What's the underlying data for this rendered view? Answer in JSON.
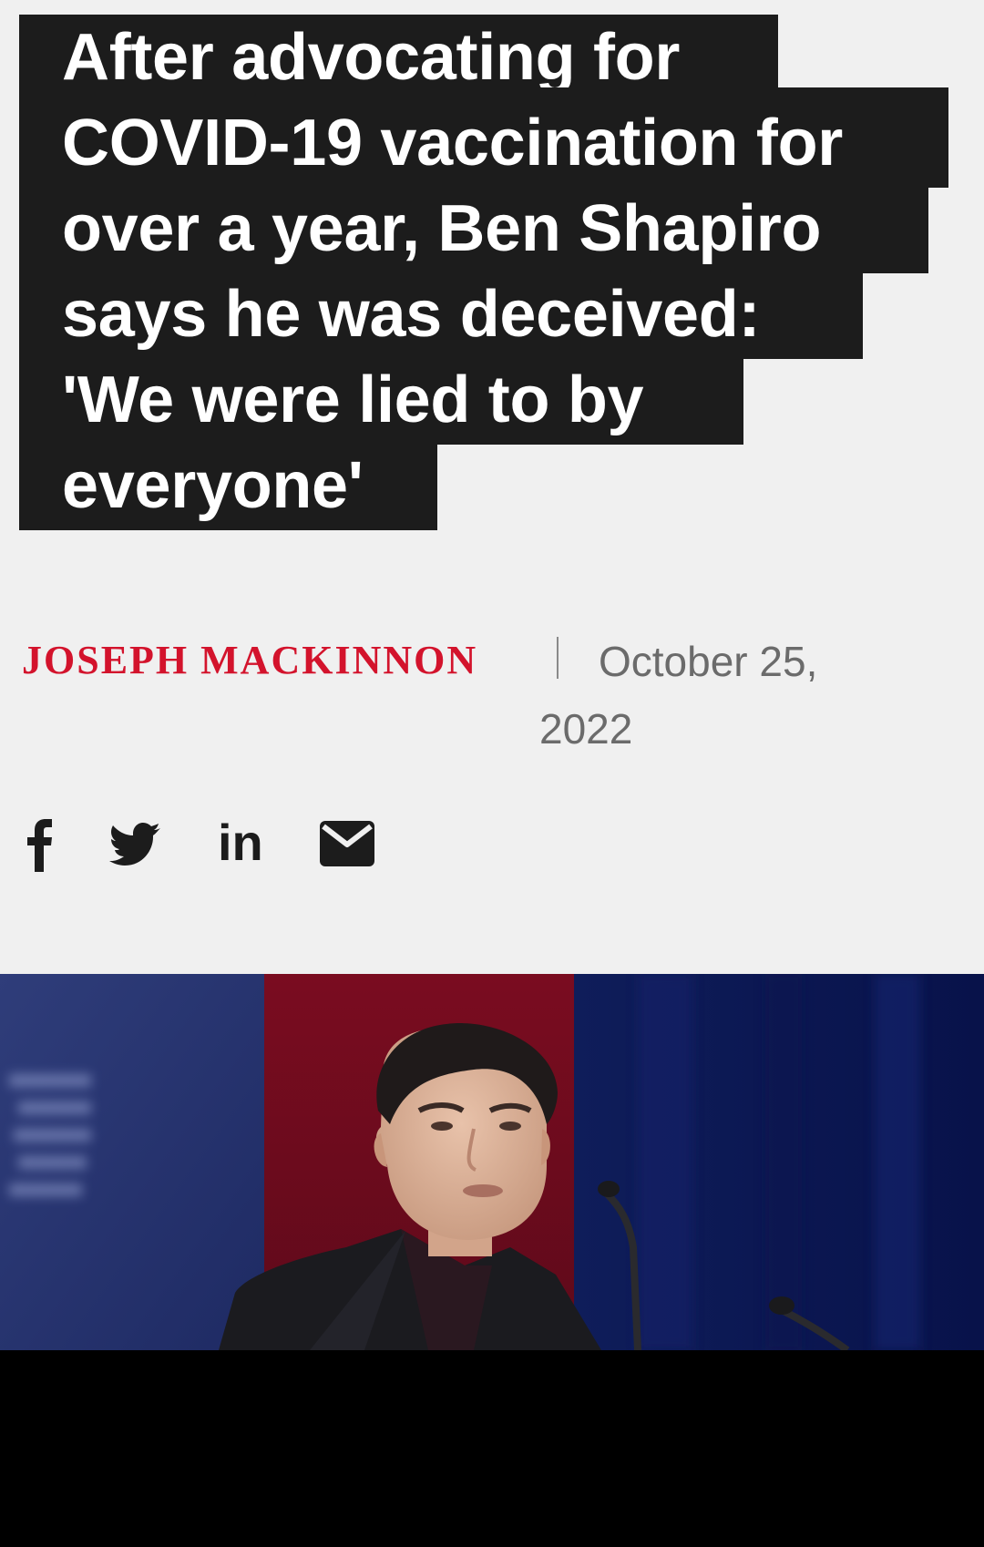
{
  "article": {
    "headline_lines": [
      "After advocating for",
      "COVID-19 vaccination for",
      "over a year, Ben Shapiro",
      "says he was deceived:",
      "'We were lied to by",
      "everyone'"
    ],
    "author": "JOSEPH MACKINNON",
    "date_line1": "October 25,",
    "date_line2": "2022"
  },
  "share": {
    "icons": [
      "facebook-icon",
      "twitter-icon",
      "linkedin-icon",
      "email-icon"
    ],
    "linkedin_text": "in"
  },
  "hero_image": {
    "description": "man in dark suit speaking at a podium with microphones",
    "colors": {
      "left_panel": "#2a3570",
      "center_panel": "#7a0f22",
      "right_panel": "#0d1a55"
    }
  },
  "colors": {
    "background": "#f0f0f0",
    "headline_bg": "#1c1c1c",
    "author": "#d3132c",
    "date": "#6b6b6b"
  }
}
